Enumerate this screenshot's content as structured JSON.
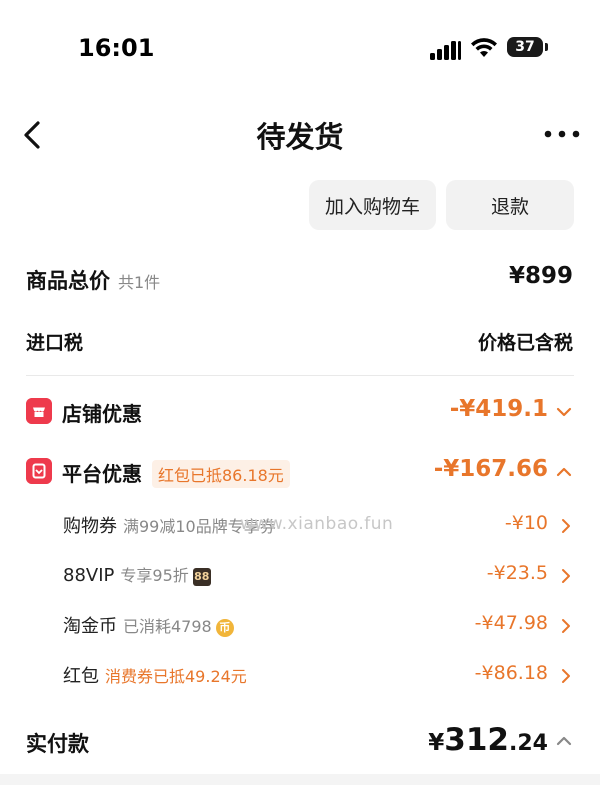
{
  "status_bar": {
    "time": "16:01",
    "battery": "37"
  },
  "nav": {
    "title": "待发货"
  },
  "actions": {
    "add_to_cart": "加入购物车",
    "refund": "退款"
  },
  "summary": {
    "total_label": "商品总价",
    "total_count": "共1件",
    "total_value": "¥899",
    "tax_label": "进口税",
    "tax_value": "价格已含税"
  },
  "store_discount": {
    "label": "店铺优惠",
    "value": "-¥419.1"
  },
  "platform_discount": {
    "label": "平台优惠",
    "pill": "红包已抵86.18元",
    "value": "-¥167.66",
    "items": [
      {
        "label": "购物券",
        "desc": "满99减10品牌专享券",
        "value": "-¥10"
      },
      {
        "label": "88VIP",
        "desc": "专享95折",
        "tag": "88",
        "value": "-¥23.5"
      },
      {
        "label": "淘金币",
        "desc": "已消耗4798",
        "tag": "币",
        "value": "-¥47.98"
      },
      {
        "label": "红包",
        "desc": "消费券已抵49.24元",
        "value": "-¥86.18"
      }
    ]
  },
  "paid": {
    "label": "实付款",
    "currency": "¥",
    "integer": "312",
    "decimal": ".24"
  },
  "watermark": "www.xianbao.fun",
  "colors": {
    "accent": "#e8762b",
    "badge_red": "#ee3a4c"
  }
}
